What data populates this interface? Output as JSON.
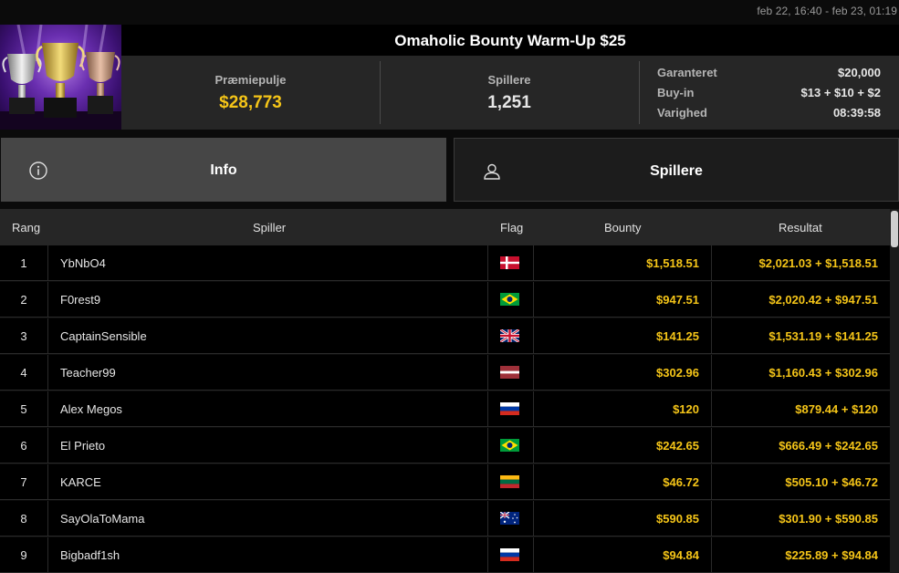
{
  "date_range": "feb 22, 16:40 - feb 23, 01:19",
  "title": "Omaholic Bounty Warm-Up $25",
  "stats": {
    "prize_pool_label": "Præmiepulje",
    "prize_pool_value": "$28,773",
    "players_label": "Spillere",
    "players_value": "1,251",
    "details": [
      {
        "key": "Garanteret",
        "value": "$20,000"
      },
      {
        "key": "Buy-in",
        "value": "$13 + $10 + $2"
      },
      {
        "key": "Varighed",
        "value": "08:39:58"
      }
    ]
  },
  "tabs": {
    "info": {
      "label": "Info",
      "icon": "info-icon"
    },
    "players": {
      "label": "Spillere",
      "icon": "user-icon"
    }
  },
  "table": {
    "headers": [
      "Rang",
      "Spiller",
      "Flag",
      "Bounty",
      "Resultat"
    ],
    "rows": [
      {
        "rank": "1",
        "name": "YbNbO4",
        "flag": "denmark",
        "bounty": "$1,518.51",
        "result": "$2,021.03 + $1,518.51"
      },
      {
        "rank": "2",
        "name": "F0rest9",
        "flag": "brazil",
        "bounty": "$947.51",
        "result": "$2,020.42 + $947.51"
      },
      {
        "rank": "3",
        "name": "CaptainSensible",
        "flag": "united-kingdom",
        "bounty": "$141.25",
        "result": "$1,531.19 + $141.25"
      },
      {
        "rank": "4",
        "name": "Teacher99",
        "flag": "latvia",
        "bounty": "$302.96",
        "result": "$1,160.43 + $302.96"
      },
      {
        "rank": "5",
        "name": "Alex Megos",
        "flag": "russia",
        "bounty": "$120",
        "result": "$879.44 + $120"
      },
      {
        "rank": "6",
        "name": "El Prieto",
        "flag": "brazil",
        "bounty": "$242.65",
        "result": "$666.49 + $242.65"
      },
      {
        "rank": "7",
        "name": "KARCE",
        "flag": "lithuania",
        "bounty": "$46.72",
        "result": "$505.10 + $46.72"
      },
      {
        "rank": "8",
        "name": "SayOlaToMama",
        "flag": "australia",
        "bounty": "$590.85",
        "result": "$301.90 + $590.85"
      },
      {
        "rank": "9",
        "name": "Bigbadf1sh",
        "flag": "russia",
        "bounty": "$94.84",
        "result": "$225.89 + $94.84"
      }
    ]
  },
  "colors": {
    "accent_gold": "#f5c518",
    "active_tab": "#464646",
    "background": "#0b0b0b"
  }
}
